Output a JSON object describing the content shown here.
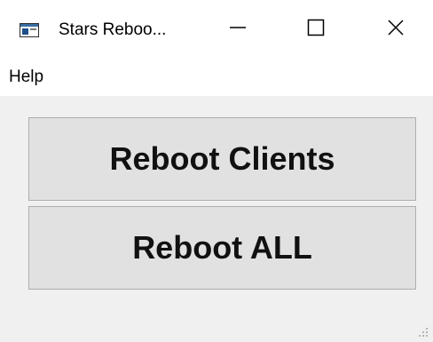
{
  "window": {
    "title": "Stars Reboo...",
    "controls": {
      "minimize_icon": "minimize-icon",
      "maximize_icon": "maximize-icon",
      "close_icon": "close-icon"
    }
  },
  "menu": {
    "items": [
      {
        "label": "Help"
      }
    ]
  },
  "actions": {
    "reboot_clients_label": "Reboot Clients",
    "reboot_all_label": "Reboot ALL"
  },
  "colors": {
    "chrome": "#ffffff",
    "client_area": "#f0f0f0",
    "button_face": "#e1e1e1",
    "button_border": "#adadad"
  }
}
